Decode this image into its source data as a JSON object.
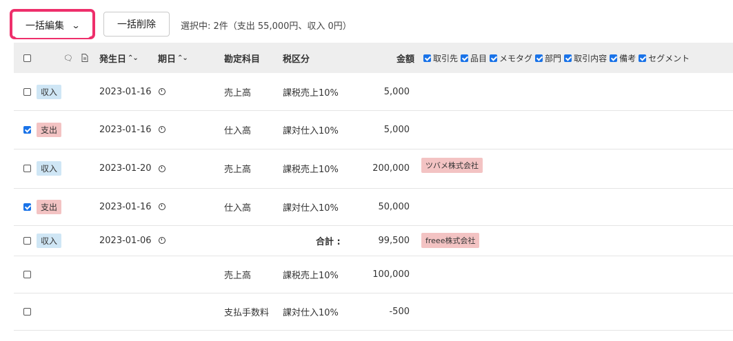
{
  "toolbar": {
    "bulk_edit_label": "一括編集",
    "bulk_edit_chevron": "⌄",
    "bulk_delete_label": "一括削除",
    "selection_status": "選択中: 2件（支出 55,000円、収入 0円）"
  },
  "table": {
    "headers": {
      "comment_icon": "comment-icon",
      "document_icon": "document-icon",
      "issue_date": "発生日",
      "due_date": "期日",
      "sort_arrows": "⌃⌄",
      "account": "勘定科目",
      "tax": "税区分",
      "amount": "金額"
    },
    "column_options": [
      {
        "label": "取引先",
        "checked": true
      },
      {
        "label": "品目",
        "checked": true
      },
      {
        "label": "メモタグ",
        "checked": true
      },
      {
        "label": "部門",
        "checked": true
      },
      {
        "label": "取引内容",
        "checked": true
      },
      {
        "label": "備考",
        "checked": true
      },
      {
        "label": "セグメント",
        "checked": true
      }
    ],
    "rows": [
      {
        "checked": false,
        "type": "収入",
        "type_kind": "income",
        "date": "2023-01-16",
        "account": "売上高",
        "tax": "課税売上10%",
        "amount": "5,000",
        "partner": ""
      },
      {
        "checked": true,
        "type": "支出",
        "type_kind": "expense",
        "date": "2023-01-16",
        "account": "仕入高",
        "tax": "課対仕入10%",
        "amount": "5,000",
        "partner": ""
      },
      {
        "checked": false,
        "type": "収入",
        "type_kind": "income",
        "date": "2023-01-20",
        "account": "売上高",
        "tax": "課税売上10%",
        "amount": "200,000",
        "partner": "ツバメ株式会社"
      },
      {
        "checked": true,
        "type": "支出",
        "type_kind": "expense",
        "date": "2023-01-16",
        "account": "仕入高",
        "tax": "課対仕入10%",
        "amount": "50,000",
        "partner": ""
      },
      {
        "checked": false,
        "type": "収入",
        "type_kind": "income",
        "date": "2023-01-06",
        "total_label": "合計 :",
        "amount": "99,500",
        "partner": "freee株式会社"
      },
      {
        "checked": false,
        "account": "売上高",
        "tax": "課税売上10%",
        "amount": "100,000"
      },
      {
        "checked": false,
        "account": "支払手数料",
        "tax": "課対仕入10%",
        "amount": "-500"
      }
    ]
  }
}
